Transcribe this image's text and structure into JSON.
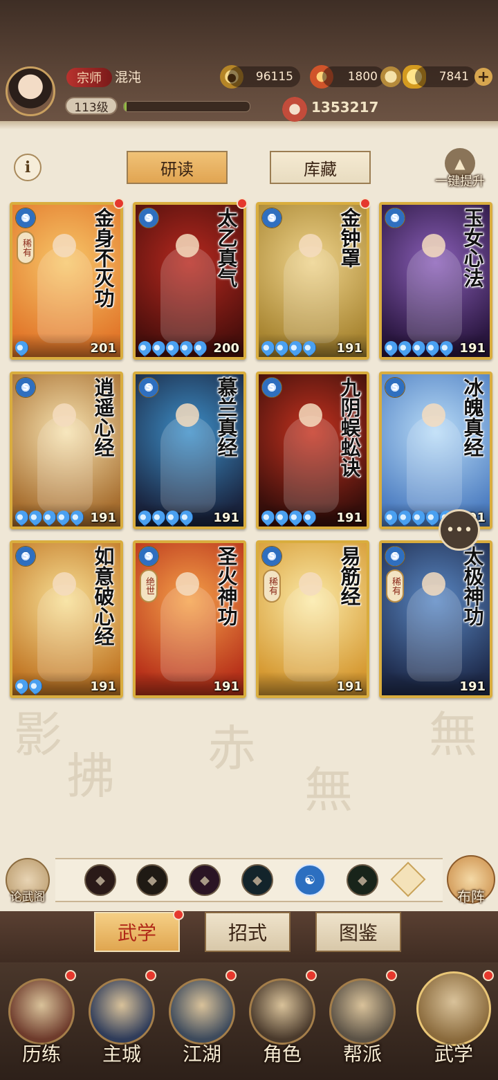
{
  "player": {
    "rank_title": "宗师",
    "name": "混沌",
    "level_label": "113级",
    "xp_progress": 0.02,
    "combat_power": "1353217"
  },
  "currencies": [
    {
      "name": "coin",
      "value": "96115",
      "icon": "coin-icon"
    },
    {
      "name": "flame",
      "value": "1800",
      "icon": "flame-icon"
    },
    {
      "name": "ingot",
      "value": "7841",
      "icon": "gold-ingot-icon"
    }
  ],
  "tabs": {
    "read": "研读",
    "collection": "库藏",
    "info_icon": "i"
  },
  "upgrade_all_label": "一键提升",
  "cards": [
    {
      "title": "金身不灭功",
      "rarity": "稀有",
      "stars": 1,
      "level": "201",
      "badge": true,
      "colors": [
        "#f7c76a",
        "#e2782b"
      ]
    },
    {
      "title": "太乙真气",
      "rarity": "",
      "stars": 5,
      "level": "200",
      "badge": true,
      "colors": [
        "#b7291f",
        "#4c0f0c"
      ]
    },
    {
      "title": "金钟罩",
      "rarity": "",
      "stars": 4,
      "level": "191",
      "badge": true,
      "colors": [
        "#eed38c",
        "#a98632"
      ]
    },
    {
      "title": "玉女心法",
      "rarity": "",
      "stars": 5,
      "level": "191",
      "badge": false,
      "colors": [
        "#8a5fb8",
        "#2b1741"
      ]
    },
    {
      "title": "逍遥心经",
      "rarity": "",
      "stars": 5,
      "level": "191",
      "badge": false,
      "colors": [
        "#f6e2b0",
        "#a76e2f"
      ]
    },
    {
      "title": "慕兰真经",
      "rarity": "",
      "stars": 4,
      "level": "191",
      "badge": false,
      "colors": [
        "#3d8fc8",
        "#1a2540"
      ]
    },
    {
      "title": "九阴蜈蚣诀",
      "rarity": "",
      "stars": 4,
      "level": "191",
      "badge": false,
      "colors": [
        "#c5321f",
        "#3a0f0b"
      ]
    },
    {
      "title": "冰魄真经",
      "rarity": "",
      "stars": 5,
      "level": "191",
      "badge": false,
      "colors": [
        "#b9dcf7",
        "#4f7fc2"
      ]
    },
    {
      "title": "如意破心经",
      "rarity": "",
      "stars": 2,
      "level": "191",
      "badge": false,
      "colors": [
        "#f7df95",
        "#c27826"
      ]
    },
    {
      "title": "圣火神功",
      "rarity": "绝世",
      "stars": 0,
      "level": "191",
      "badge": false,
      "colors": [
        "#f5a24a",
        "#b8321a"
      ]
    },
    {
      "title": "易筋经",
      "rarity": "稀有",
      "stars": 0,
      "level": "191",
      "badge": false,
      "colors": [
        "#fbeaa8",
        "#d69a33"
      ]
    },
    {
      "title": "太极神功",
      "rarity": "稀有",
      "stars": 0,
      "level": "191",
      "badge": false,
      "colors": [
        "#5a88c4",
        "#1f2c4d"
      ]
    }
  ],
  "skill_bar": {
    "left_button": "论武阁",
    "right_button": "布阵",
    "slots": [
      {
        "icon": "sword-school-icon",
        "color": "#2a1a18"
      },
      {
        "icon": "staff-school-icon",
        "color": "#1f1a14"
      },
      {
        "icon": "claw-school-icon",
        "color": "#2a1424"
      },
      {
        "icon": "fan-school-icon",
        "color": "#13242b"
      },
      {
        "icon": "taiji-school-icon",
        "color": "#2c6fc0"
      },
      {
        "icon": "gourd-school-icon",
        "color": "#18241a"
      }
    ]
  },
  "subtabs": [
    {
      "label": "武学",
      "active": true,
      "badge": true
    },
    {
      "label": "招式",
      "active": false,
      "badge": false
    },
    {
      "label": "图鉴",
      "active": false,
      "badge": false
    }
  ],
  "bottom_nav": [
    {
      "label": "历练",
      "icon": "scroll-sword-icon",
      "badge": true,
      "active": false
    },
    {
      "label": "主城",
      "icon": "city-gate-icon",
      "badge": true,
      "active": false
    },
    {
      "label": "江湖",
      "icon": "blade-icon",
      "badge": true,
      "active": false
    },
    {
      "label": "角色",
      "icon": "hat-character-icon",
      "badge": true,
      "active": false
    },
    {
      "label": "帮派",
      "icon": "gang-emblem-icon",
      "badge": true,
      "active": false
    },
    {
      "label": "武学",
      "icon": "scroll-stack-icon",
      "badge": true,
      "active": true
    }
  ]
}
